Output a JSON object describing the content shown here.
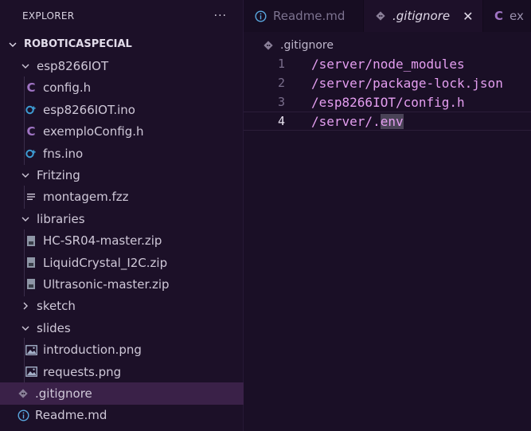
{
  "explorer": {
    "title": "EXPLORER",
    "more": "···",
    "root": "ROBOTICASPECIAL",
    "items": [
      {
        "label": "esp8266IOT",
        "type": "folder",
        "depth": 1,
        "open": true
      },
      {
        "label": "config.h",
        "type": "c",
        "depth": 2
      },
      {
        "label": "esp8266IOT.ino",
        "type": "ino",
        "depth": 2
      },
      {
        "label": "exemploConfig.h",
        "type": "c",
        "depth": 2
      },
      {
        "label": "fns.ino",
        "type": "ino",
        "depth": 2
      },
      {
        "label": "Fritzing",
        "type": "folder",
        "depth": 1,
        "open": true
      },
      {
        "label": "montagem.fzz",
        "type": "fzz",
        "depth": 2
      },
      {
        "label": "libraries",
        "type": "folder",
        "depth": 1,
        "open": true
      },
      {
        "label": "HC-SR04-master.zip",
        "type": "zip",
        "depth": 2
      },
      {
        "label": "LiquidCrystal_I2C.zip",
        "type": "zip",
        "depth": 2
      },
      {
        "label": "Ultrasonic-master.zip",
        "type": "zip",
        "depth": 2
      },
      {
        "label": "sketch",
        "type": "folder",
        "depth": 1,
        "open": false
      },
      {
        "label": "slides",
        "type": "folder",
        "depth": 1,
        "open": true
      },
      {
        "label": "introduction.png",
        "type": "img",
        "depth": 2
      },
      {
        "label": "requests.png",
        "type": "img",
        "depth": 2
      },
      {
        "label": ".gitignore",
        "type": "git",
        "depth": 1,
        "selected": true
      },
      {
        "label": "Readme.md",
        "type": "info",
        "depth": 1
      }
    ]
  },
  "tabs": [
    {
      "label": "Readme.md",
      "icon": "info-icon",
      "active": false
    },
    {
      "label": ".gitignore",
      "icon": "git-icon",
      "active": true,
      "close": "✕"
    },
    {
      "label": "ex",
      "icon": "c-icon",
      "active": false
    }
  ],
  "breadcrumb": {
    "file": ".gitignore"
  },
  "editor": {
    "lines": [
      {
        "num": "1",
        "text": "/server/node_modules"
      },
      {
        "num": "2",
        "text": "/server/package-lock.json"
      },
      {
        "num": "3",
        "text": "/esp8266IOT/config.h"
      },
      {
        "num": "4",
        "text": "/server/.",
        "highlight": "env",
        "current": true
      }
    ]
  },
  "colors": {
    "accent": "#e49ef0",
    "c_icon": "#a074c4",
    "ino_icon": "#3d9ad1",
    "selected": "#3a2148"
  }
}
